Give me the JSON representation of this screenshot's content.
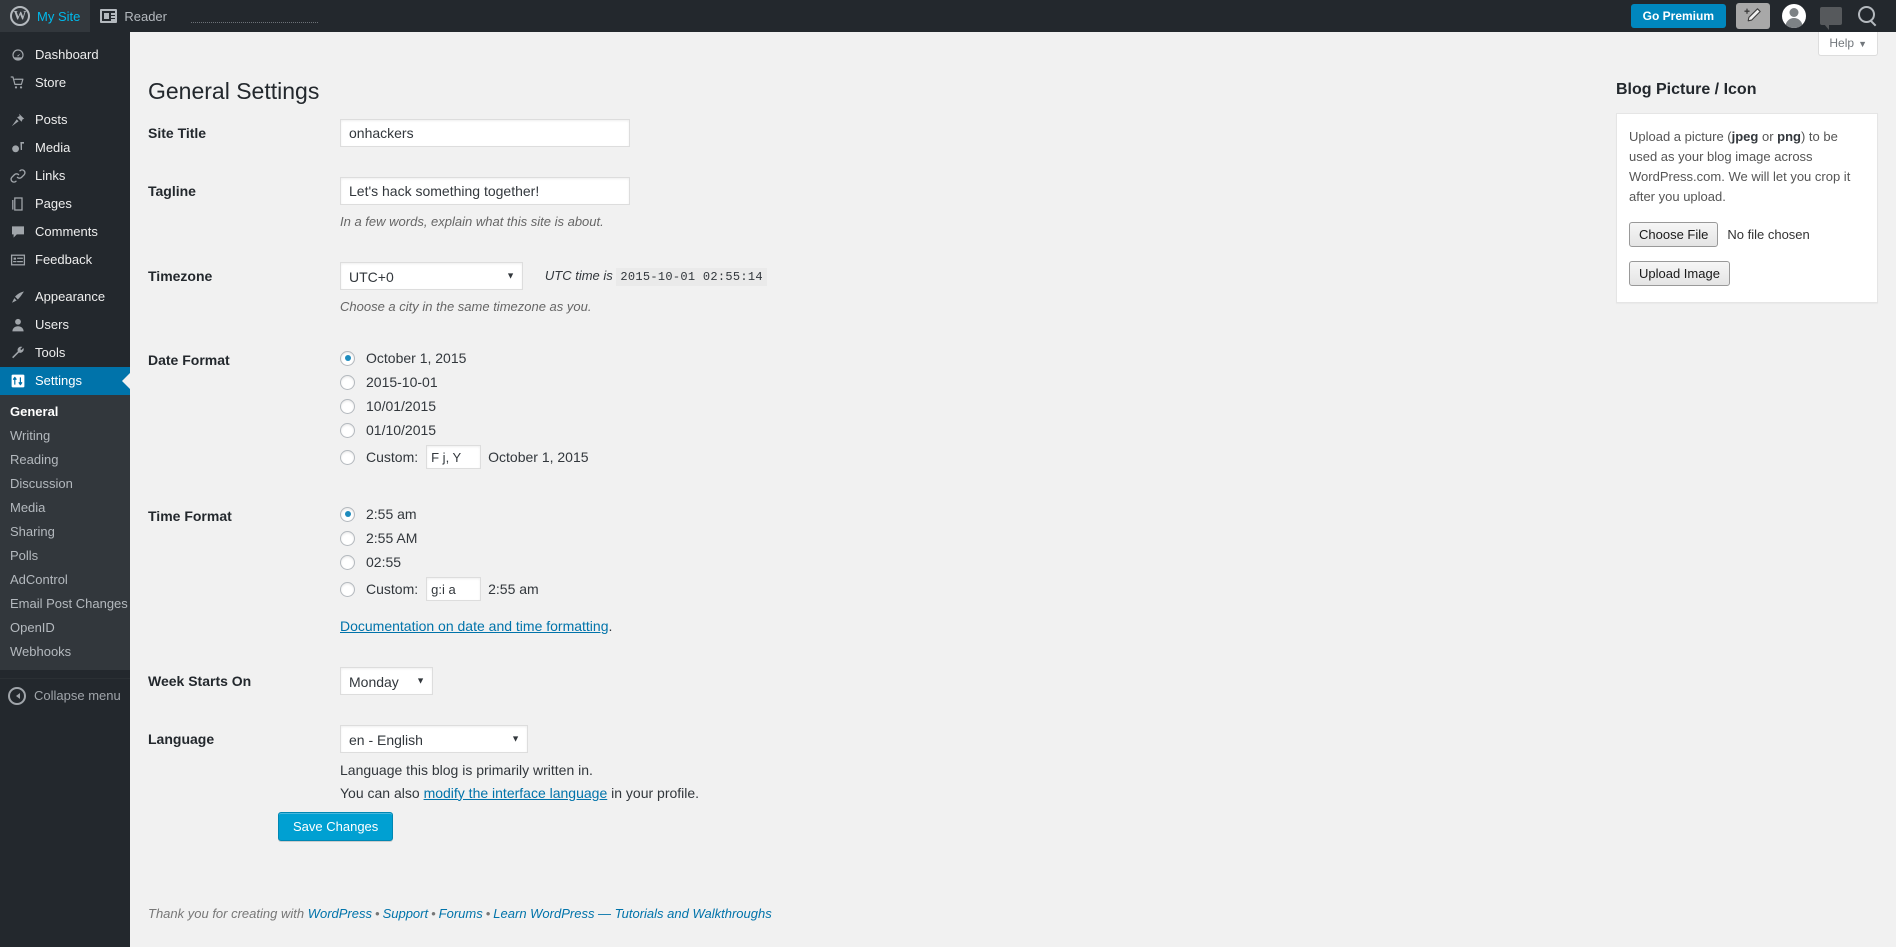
{
  "adminbar": {
    "my_site": "My Site",
    "reader": "Reader",
    "go_premium": "Go Premium",
    "icons": {
      "wordpress": "wordpress-logo-icon",
      "reader": "reader-icon",
      "new_post": "new-post-pencil-icon",
      "avatar": "avatar-icon",
      "comments": "comment-bubble-icon",
      "search": "search-icon"
    }
  },
  "sidebar": {
    "items": [
      {
        "label": "Dashboard",
        "icon": "dashboard-icon",
        "glyph": "◐"
      },
      {
        "label": "Store",
        "icon": "store-cart-icon",
        "glyph": "🛒"
      },
      {
        "label": "Posts",
        "icon": "posts-pin-icon",
        "glyph": "✎"
      },
      {
        "label": "Media",
        "icon": "media-icon",
        "glyph": "♪"
      },
      {
        "label": "Links",
        "icon": "links-chain-icon",
        "glyph": "🔗"
      },
      {
        "label": "Pages",
        "icon": "pages-icon",
        "glyph": "❐"
      },
      {
        "label": "Comments",
        "icon": "comments-icon",
        "glyph": "💬"
      },
      {
        "label": "Feedback",
        "icon": "feedback-icon",
        "glyph": "☰"
      },
      {
        "label": "Appearance",
        "icon": "appearance-brush-icon",
        "glyph": "✐"
      },
      {
        "label": "Users",
        "icon": "users-icon",
        "glyph": "👤"
      },
      {
        "label": "Tools",
        "icon": "tools-wrench-icon",
        "glyph": "🔧"
      },
      {
        "label": "Settings",
        "icon": "settings-icon",
        "glyph": "⚙"
      }
    ],
    "submenu": [
      "General",
      "Writing",
      "Reading",
      "Discussion",
      "Media",
      "Sharing",
      "Polls",
      "AdControl",
      "Email Post Changes",
      "OpenID",
      "Webhooks"
    ],
    "active_submenu": "General",
    "collapse_label": "Collapse menu"
  },
  "help_tab": {
    "label": "Help",
    "caret": "▼"
  },
  "page": {
    "title": "General Settings"
  },
  "form": {
    "site_title": {
      "label": "Site Title",
      "value": "onhackers"
    },
    "tagline": {
      "label": "Tagline",
      "value": "Let's hack something together!",
      "description": "In a few words, explain what this site is about."
    },
    "timezone": {
      "label": "Timezone",
      "value": "UTC+0",
      "utc_prefix": "UTC time is",
      "utc_time": "2015-10-01 02:55:14",
      "description": "Choose a city in the same timezone as you."
    },
    "date_format": {
      "label": "Date Format",
      "options": [
        {
          "label": "October 1, 2015",
          "checked": true
        },
        {
          "label": "2015-10-01",
          "checked": false
        },
        {
          "label": "10/01/2015",
          "checked": false
        },
        {
          "label": "01/10/2015",
          "checked": false
        }
      ],
      "custom_label": "Custom:",
      "custom_value": "F j, Y",
      "custom_preview": "October 1, 2015"
    },
    "time_format": {
      "label": "Time Format",
      "options": [
        {
          "label": "2:55 am",
          "checked": true
        },
        {
          "label": "2:55 AM",
          "checked": false
        },
        {
          "label": "02:55",
          "checked": false
        }
      ],
      "custom_label": "Custom:",
      "custom_value": "g:i a",
      "custom_preview": "2:55 am",
      "doc_link": "Documentation on date and time formatting",
      "doc_suffix": "."
    },
    "week_starts_on": {
      "label": "Week Starts On",
      "value": "Monday"
    },
    "language": {
      "label": "Language",
      "value": "en - English",
      "description": "Language this blog is primarily written in.",
      "profile_prefix": "You can also ",
      "profile_link": "modify the interface language",
      "profile_suffix": " in your profile."
    },
    "save_button": "Save Changes"
  },
  "blog_picture": {
    "title": "Blog Picture / Icon",
    "desc_1": "Upload a picture (",
    "desc_jpeg": "jpeg",
    "desc_2": " or ",
    "desc_png": "png",
    "desc_3": ") to be used as your blog image across WordPress.com. We will let you crop it after you upload.",
    "choose_file": "Choose File",
    "no_file": "No file chosen",
    "upload_image": "Upload Image"
  },
  "footer": {
    "thanks": "Thank you for creating with",
    "wordpress": "WordPress",
    "support": "Support",
    "forums": "Forums",
    "learn": "Learn WordPress — Tutorials and Walkthroughs",
    "sep": "•"
  },
  "colors": {
    "accent": "#0073aa",
    "button": "#00a0d2",
    "admin_bg": "#23282d",
    "submenu_bg": "#32373c",
    "premium": "#0087be"
  }
}
